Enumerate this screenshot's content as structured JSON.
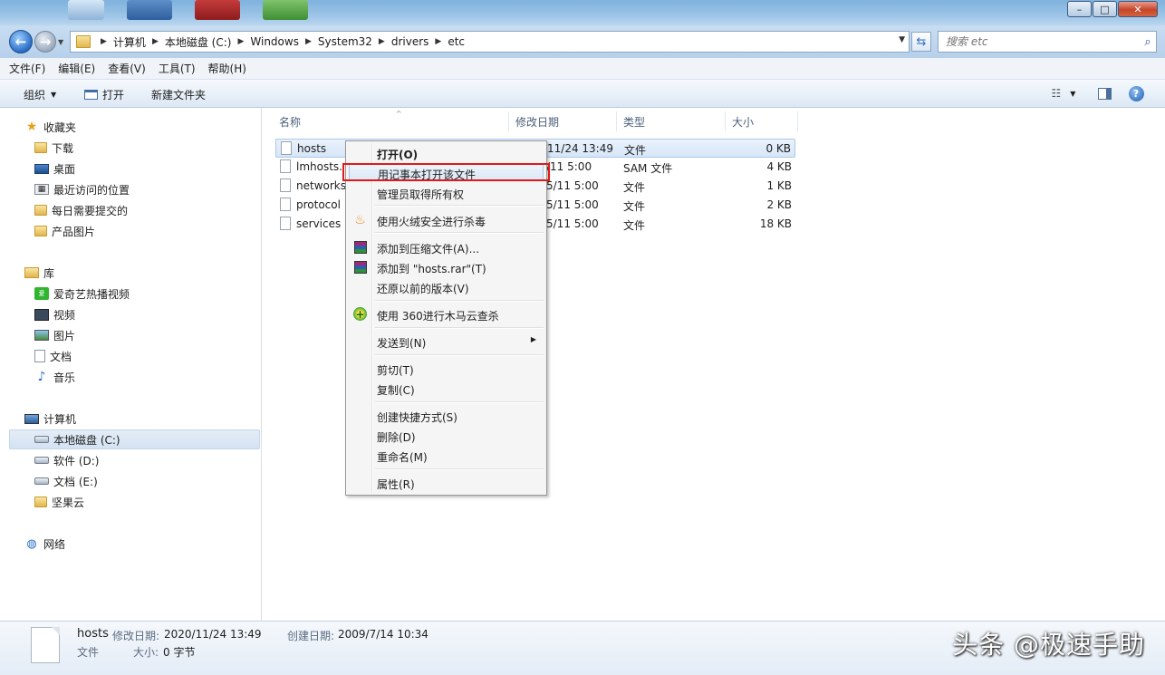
{
  "window": {
    "buttons": {
      "minimize": "–",
      "maximize": "□",
      "close": "✕"
    }
  },
  "nav": {
    "back_icon": "arrow-left-icon",
    "forward_icon": "arrow-right-icon",
    "breadcrumb": [
      "计算机",
      "本地磁盘 (C:)",
      "Windows",
      "System32",
      "drivers",
      "etc"
    ],
    "search_placeholder": "搜索 etc"
  },
  "menubar": [
    "文件(F)",
    "编辑(E)",
    "查看(V)",
    "工具(T)",
    "帮助(H)"
  ],
  "toolbar": {
    "organize": "组织",
    "open": "打开",
    "new_folder": "新建文件夹"
  },
  "sidebar": {
    "favorites": {
      "label": "收藏夹",
      "items": [
        "下载",
        "桌面",
        "最近访问的位置",
        "每日需要提交的",
        "产品图片"
      ]
    },
    "libraries": {
      "label": "库",
      "items": [
        "爱奇艺热播视频",
        "视频",
        "图片",
        "文档",
        "音乐"
      ]
    },
    "computer": {
      "label": "计算机",
      "items": [
        "本地磁盘 (C:)",
        "软件 (D:)",
        "文档 (E:)",
        "坚果云"
      ]
    },
    "network": {
      "label": "网络"
    }
  },
  "columns": {
    "name": "名称",
    "modified": "修改日期",
    "type": "类型",
    "size": "大小"
  },
  "files": [
    {
      "name": "hosts",
      "modified": "11/24 13:49",
      "type": "文件",
      "size": "0 KB"
    },
    {
      "name": "lmhosts.",
      "modified": "/11 5:00",
      "type": "SAM 文件",
      "size": "4 KB"
    },
    {
      "name": "networks",
      "modified": "5/11 5:00",
      "type": "文件",
      "size": "1 KB"
    },
    {
      "name": "protocol",
      "modified": "5/11 5:00",
      "type": "文件",
      "size": "2 KB"
    },
    {
      "name": "services",
      "modified": "5/11 5:00",
      "type": "文件",
      "size": "18 KB"
    }
  ],
  "context_menu": [
    {
      "label": "打开(O)",
      "bold": true
    },
    {
      "label": "用记事本打开该文件",
      "highlight": true
    },
    {
      "label": "管理员取得所有权"
    },
    {
      "label": "使用火绒安全进行杀毒",
      "icon": "huorong-shield-icon"
    },
    {
      "label": "添加到压缩文件(A)...",
      "icon": "winrar-icon"
    },
    {
      "label": "添加到 \"hosts.rar\"(T)",
      "icon": "winrar-icon"
    },
    {
      "label": "还原以前的版本(V)"
    },
    {
      "label": "使用 360进行木马云查杀",
      "icon": "360-icon"
    },
    {
      "label": "发送到(N)",
      "submenu": true
    },
    {
      "label": "剪切(T)"
    },
    {
      "label": "复制(C)"
    },
    {
      "label": "创建快捷方式(S)"
    },
    {
      "label": "删除(D)"
    },
    {
      "label": "重命名(M)"
    },
    {
      "label": "属性(R)"
    }
  ],
  "details": {
    "name": "hosts",
    "modified_label": "修改日期:",
    "modified": "2020/11/24 13:49",
    "created_label": "创建日期:",
    "created": "2009/7/14 10:34",
    "type": "文件",
    "size_label": "大小:",
    "size": "0 字节"
  },
  "watermark": "头条 @极速手助",
  "colors": {
    "highlight_box": "#e01919",
    "accent": "#2a6cc4"
  }
}
